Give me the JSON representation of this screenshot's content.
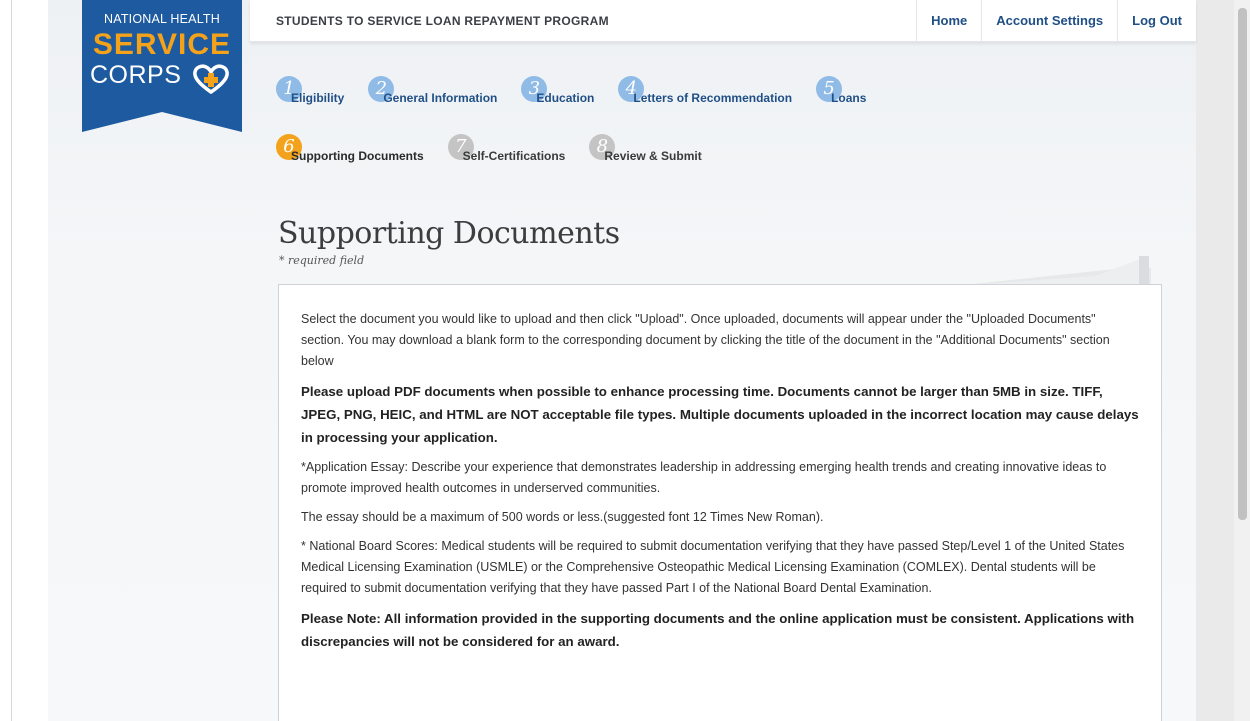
{
  "header": {
    "program_title": "STUDENTS TO SERVICE LOAN REPAYMENT PROGRAM",
    "nav": [
      "Home",
      "Account Settings",
      "Log Out"
    ]
  },
  "logo": {
    "line1": "NATIONAL HEALTH",
    "line2": "SERVICE",
    "line3": "CORPS"
  },
  "steps": [
    {
      "number": "1",
      "label": "Eligibility",
      "state": "complete"
    },
    {
      "number": "2",
      "label": "General Information",
      "state": "complete"
    },
    {
      "number": "3",
      "label": "Education",
      "state": "complete"
    },
    {
      "number": "4",
      "label": "Letters of Recommendation",
      "state": "complete"
    },
    {
      "number": "5",
      "label": "Loans",
      "state": "complete"
    },
    {
      "number": "6",
      "label": "Supporting Documents",
      "state": "active"
    },
    {
      "number": "7",
      "label": "Self-Certifications",
      "state": "future"
    },
    {
      "number": "8",
      "label": "Review & Submit",
      "state": "future"
    }
  ],
  "page": {
    "title": "Supporting Documents",
    "required_note": "* required field"
  },
  "content": {
    "intro": "Select the document you would like to upload and then click \"Upload\". Once uploaded, documents will appear under the \"Uploaded Documents\" section. You may download a blank form to the corresponding document by clicking the title of the document in the \"Additional Documents\" section below",
    "pdf_notice": "Please upload PDF documents when possible to enhance processing time. Documents cannot be larger than 5MB in size. TIFF, JPEG, PNG, HEIC, and HTML are NOT acceptable file types. Multiple documents uploaded in the incorrect location may cause delays in processing your application.",
    "essay": "*Application Essay: Describe your experience that demonstrates leadership in addressing emerging health trends and creating innovative ideas to promote improved health outcomes in underserved communities.",
    "essay_length": "The essay should be a maximum of 500 words or less.(suggested font 12 Times New Roman).",
    "board_scores": "* National Board Scores: Medical students will be required to submit documentation verifying that they have passed Step/Level 1 of the United States Medical Licensing Examination (USMLE) or the Comprehensive Osteopathic Medical Licensing Examination (COMLEX). Dental students will be required to submit documentation verifying that they have passed Part I of the National Board Dental Examination.",
    "consistency_note": "Please Note: All information provided in the supporting documents and the online application must be consistent. Applications with discrepancies will not be considered for an award."
  },
  "colors": {
    "nav_blue": "#1f4f86",
    "logo_blue": "#1d5aa0",
    "logo_orange": "#f4a21a",
    "step_blue": "#8fbbe6",
    "step_active": "#f3a21b",
    "step_future": "#c4c4c4"
  }
}
